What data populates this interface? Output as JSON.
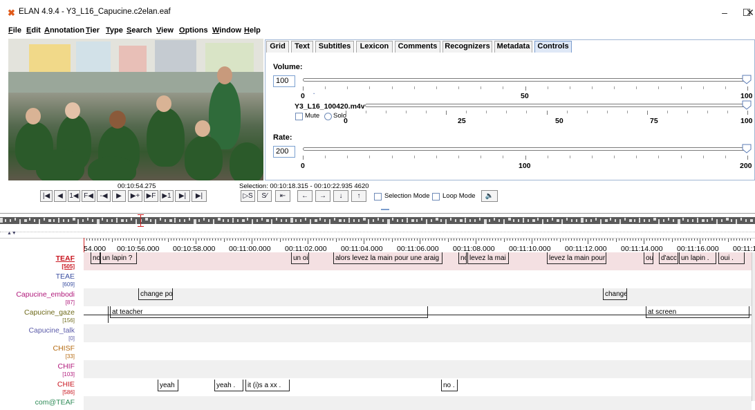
{
  "window": {
    "title": "ELAN 4.9.4 - Y3_L16_Capucine.c2elan.eaf",
    "minimize": "–",
    "maximize": "☐",
    "close": "✕"
  },
  "menu": [
    "File",
    "Edit",
    "Annotation",
    "Tier",
    "Type",
    "Search",
    "View",
    "Options",
    "Window",
    "Help"
  ],
  "tabs": [
    "Grid",
    "Text",
    "Subtitles",
    "Lexicon",
    "Comments",
    "Recognizers",
    "Metadata",
    "Controls"
  ],
  "active_tab": "Controls",
  "controls": {
    "volume_label": "Volume:",
    "volume_value": "100",
    "volume_level": 1.0,
    "volume_ticks": [
      "0",
      "50",
      "100"
    ],
    "media_file": "Y3_L16_100420.m4v",
    "mute_label": "Mute",
    "solo_label": "Solo",
    "media_level": 1.0,
    "media_ticks": [
      "0",
      "25",
      "50",
      "75",
      "100"
    ],
    "rate_label": "Rate:",
    "rate_value": "200",
    "rate_level": 1.0,
    "rate_ticks": [
      "0",
      "100",
      "200"
    ]
  },
  "player": {
    "time": "00:10:54.275",
    "selection": "Selection: 00:10:18.315 - 00:10:22.935  4620",
    "selection_mode": "Selection Mode",
    "loop_mode": "Loop Mode",
    "buttons": [
      "|◀",
      "◀",
      "1◀",
      "F◀",
      "-◀",
      "▶",
      "▶+",
      "▶F",
      "▶1",
      "▶|",
      "▶|"
    ],
    "sel_buttons": [
      "▷S",
      "S⁄",
      "⇤",
      "←",
      "→",
      "↓",
      "↑"
    ],
    "speaker_icon": "speaker-icon"
  },
  "ruler": {
    "first_label": "54.000",
    "labels": [
      "00:10:56.000",
      "00:10:58.000",
      "00:11:00.000",
      "00:11:02.000",
      "00:11:04.000",
      "00:11:06.000",
      "00:11:08.000",
      "00:11:10.000",
      "00:11:12.000",
      "00:11:14.000",
      "00:11:16.000",
      "00:11:1"
    ]
  },
  "tiers": [
    {
      "name": "TEAF",
      "count": "[505]",
      "color": "#c8141e",
      "bold": true
    },
    {
      "name": "TEAE",
      "count": "[609]",
      "color": "#3a4ea0",
      "bold": false
    },
    {
      "name": "Capucine_embodi",
      "count": "[87]",
      "color": "#b0187a",
      "bold": false
    },
    {
      "name": "Capucine_gaze",
      "count": "[156]",
      "color": "#6e6a1a",
      "bold": false
    },
    {
      "name": "Capucine_talk",
      "count": "[0]",
      "color": "#5a5aa8",
      "bold": false
    },
    {
      "name": "CHISF",
      "count": "[33]",
      "color": "#b56a10",
      "bold": false
    },
    {
      "name": "CHIF",
      "count": "[103]",
      "color": "#b0187a",
      "bold": false
    },
    {
      "name": "CHIE",
      "count": "[586]",
      "color": "#c8141e",
      "bold": false
    },
    {
      "name": "com@TEAF",
      "count": "",
      "color": "#2e8b57",
      "bold": false
    }
  ],
  "annotations": {
    "teaf": [
      "no",
      "un lapin ?",
      "un oi",
      "alors levez la main pour une araig",
      "no",
      "levez la mai",
      "levez la main pour",
      "oui",
      "d'acc",
      "un lapin .",
      "oui ."
    ],
    "embodi": [
      "change po",
      "change"
    ],
    "gaze": [
      "at teacher",
      "at screen"
    ],
    "chie": [
      "yeah",
      "yeah .",
      "it (i)s a xx .",
      "no ."
    ]
  }
}
